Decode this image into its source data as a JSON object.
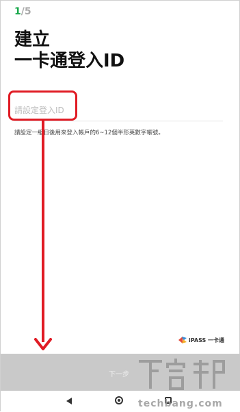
{
  "step": {
    "current": "1",
    "total": "/5"
  },
  "title": {
    "line1": "建立",
    "line2": "一卡通登入ID"
  },
  "id_input": {
    "placeholder": "請設定登入ID",
    "value": ""
  },
  "hint": "請設定一組日後用來登入帳戶的6~12個半形英數字帳號。",
  "brand": {
    "text": "iPASS 一卡通"
  },
  "next_button": {
    "label": "下一步"
  },
  "watermark": {
    "text": "techbang.com"
  },
  "annotation": {
    "color": "#e01b24"
  },
  "colors": {
    "step_active": "#18a84b",
    "next_bar": "#c9c9c9"
  },
  "icons": [
    "back-icon",
    "home-icon",
    "recent-apps-icon",
    "ipass-logo-icon"
  ]
}
